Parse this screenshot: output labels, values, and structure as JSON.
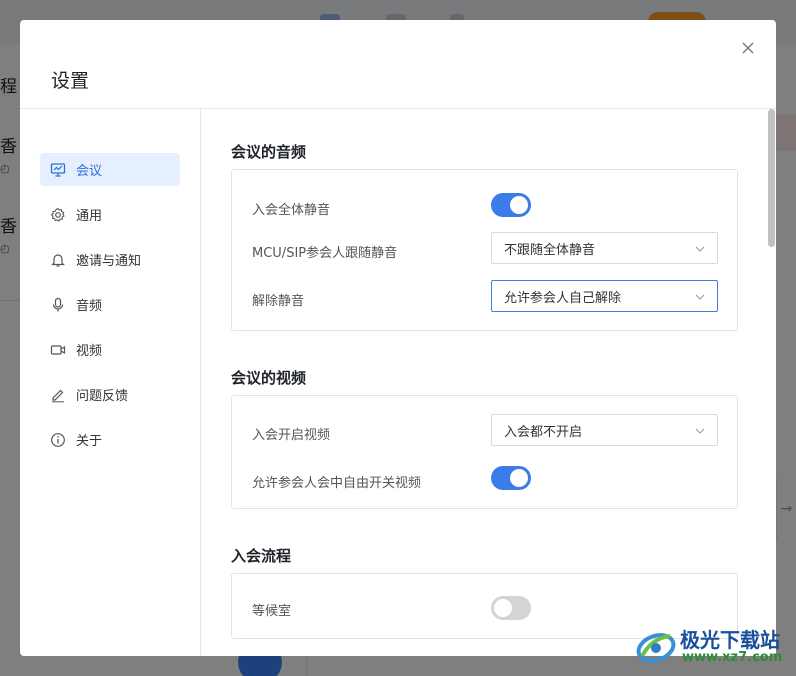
{
  "background": {
    "left_titles": [
      "程",
      "香",
      "香"
    ]
  },
  "dialog": {
    "title": "设置",
    "close_icon": "close-icon"
  },
  "sidebar": {
    "items": [
      {
        "label": "会议",
        "icon": "presentation-icon",
        "active": true
      },
      {
        "label": "通用",
        "icon": "gear-icon",
        "active": false
      },
      {
        "label": "邀请与通知",
        "icon": "bell-icon",
        "active": false
      },
      {
        "label": "音频",
        "icon": "microphone-icon",
        "active": false
      },
      {
        "label": "视频",
        "icon": "video-camera-icon",
        "active": false
      },
      {
        "label": "问题反馈",
        "icon": "pencil-icon",
        "active": false
      },
      {
        "label": "关于",
        "icon": "info-icon",
        "active": false
      }
    ]
  },
  "sections": {
    "audio": {
      "title": "会议的音频",
      "mute_all_on_join": {
        "label": "入会全体静音",
        "value": true
      },
      "mcu_sip_follow": {
        "label": "MCU/SIP参会人跟随静音",
        "value": "不跟随全体静音"
      },
      "unmute": {
        "label": "解除静音",
        "value": "允许参会人自己解除"
      }
    },
    "video": {
      "title": "会议的视频",
      "video_on_join": {
        "label": "入会开启视频",
        "value": "入会都不开启"
      },
      "allow_toggle_video": {
        "label": "允许参会人会中自由开关视频",
        "value": true
      }
    },
    "join_flow": {
      "title": "入会流程",
      "waiting_room": {
        "label": "等候室",
        "value": false
      }
    }
  },
  "watermark": {
    "name": "极光下载站",
    "url": "www.xz7.com"
  },
  "colors": {
    "accent": "#3b7bea",
    "active_nav_bg": "#e6effd",
    "toggle_off": "#d4d4d4"
  }
}
